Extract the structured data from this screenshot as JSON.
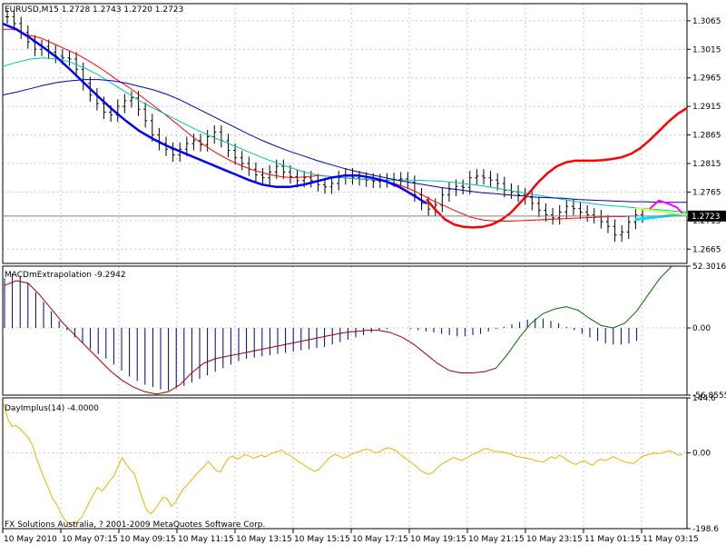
{
  "chart_data": [
    {
      "type": "candlestick",
      "title": "EURUSD,M15  1.2728 1.2743 1.2720 1.2723",
      "ylim": [
        1.264,
        1.3095
      ],
      "yticks": [
        "1.3065",
        "1.3015",
        "1.2965",
        "1.2915",
        "1.2865",
        "1.2815",
        "1.2765",
        "1.2715",
        "1.2665"
      ],
      "current_price": "1.2723",
      "bars": [
        1.3072,
        1.306,
        1.3045,
        1.3028,
        1.3015,
        1.302,
        1.301,
        1.3003,
        1.3,
        1.2998,
        1.298,
        1.2955,
        1.2935,
        1.292,
        1.2905,
        1.29,
        1.2915,
        1.2925,
        1.293,
        1.291,
        1.289,
        1.2865,
        1.285,
        1.284,
        1.283,
        1.284,
        1.285,
        1.2855,
        1.2848,
        1.2862,
        1.287,
        1.2855,
        1.2838,
        1.2825,
        1.2815,
        1.2805,
        1.2795,
        1.279,
        1.28,
        1.281,
        1.28,
        1.2792,
        1.2785,
        1.279,
        1.2785,
        1.2778,
        1.2774,
        1.278,
        1.279,
        1.2795,
        1.279,
        1.2788,
        1.2786,
        1.2784,
        1.2785,
        1.2786,
        1.2787,
        1.2788,
        1.2782,
        1.276,
        1.2745,
        1.2735,
        1.2742,
        1.276,
        1.277,
        1.2775,
        1.2773,
        1.279,
        1.2793,
        1.279,
        1.2786,
        1.278,
        1.2768,
        1.2765,
        1.276,
        1.2755,
        1.2745,
        1.2733,
        1.2725,
        1.272,
        1.273,
        1.274,
        1.2736,
        1.273,
        1.2725,
        1.2722,
        1.2713,
        1.2705,
        1.269,
        1.2695,
        1.2712,
        1.2725,
        1.2723
      ],
      "series": [
        {
          "values": [
            1.305,
            1.305,
            1.304,
            1.3035,
            1.3025,
            1.3015,
            1.3005,
            1.2992,
            1.2978,
            1.2962,
            1.2948,
            1.2932,
            1.2915,
            1.2898,
            1.288,
            1.2862,
            1.2846,
            1.2832,
            1.282,
            1.281,
            1.2802,
            1.2796,
            1.2792,
            1.279,
            1.2792,
            1.2794,
            1.2792,
            1.279,
            1.2788,
            1.2787,
            1.2785,
            1.278,
            1.2772,
            1.2762,
            1.275,
            1.274,
            1.273,
            1.2721,
            1.2716,
            1.2714,
            1.2714,
            1.2715,
            1.2716,
            1.2717,
            1.2718,
            1.2719,
            1.272,
            1.2721,
            1.2722,
            1.2722,
            1.2723
          ],
          "color": "#ff0000"
        },
        {
          "values": [
            1.2985,
            1.2992,
            1.2998,
            1.3,
            1.2998,
            1.2992,
            1.2982,
            1.297,
            1.2955,
            1.294,
            1.2925,
            1.2912,
            1.29,
            1.2888,
            1.2876,
            1.2865,
            1.2855,
            1.2845,
            1.2835,
            1.2825,
            1.2816,
            1.2808,
            1.28,
            1.2795,
            1.2792,
            1.279,
            1.2788,
            1.2787,
            1.2786,
            1.2786,
            1.2786,
            1.2785,
            1.2784,
            1.2782,
            1.2779,
            1.2776,
            1.2772,
            1.2768,
            1.2764,
            1.276,
            1.2756,
            1.2752,
            1.2748,
            1.2745,
            1.2742,
            1.274,
            1.2738,
            1.2736,
            1.2734,
            1.2732,
            1.273
          ],
          "color": "#00c8a0"
        },
        {
          "values": [
            1.2935,
            1.294,
            1.2946,
            1.2952,
            1.2957,
            1.296,
            1.2962,
            1.2962,
            1.296,
            1.2956,
            1.295,
            1.2944,
            1.2936,
            1.2926,
            1.2914,
            1.2902,
            1.289,
            1.2878,
            1.2866,
            1.2855,
            1.2845,
            1.2836,
            1.2828,
            1.282,
            1.2813,
            1.2806,
            1.28,
            1.2795,
            1.279,
            1.2785,
            1.2781,
            1.2777,
            1.2773,
            1.277,
            1.2767,
            1.2764,
            1.2762,
            1.276,
            1.2758,
            1.2756,
            1.2755,
            1.2754,
            1.2752,
            1.2751,
            1.275,
            1.2749,
            1.2748,
            1.2748,
            1.2747,
            1.2747,
            1.2747
          ],
          "color": "#0000b4"
        },
        {
          "values": [
            1.306,
            1.305,
            1.3035,
            1.3018,
            1.3,
            1.2978,
            1.2955,
            1.2932,
            1.291,
            1.289,
            1.2872,
            1.2858,
            1.2846,
            1.2836,
            1.2826,
            1.2816,
            1.2806,
            1.2796,
            1.2786,
            1.2778,
            1.2774,
            1.2774,
            1.2778,
            1.2784,
            1.279,
            1.2794,
            1.2794,
            1.279,
            1.2784,
            1.2774,
            1.276,
            1.2745
          ],
          "color": "#0000ff"
        },
        {
          "values": [
            1.2752,
            1.2733,
            1.2717,
            1.2708,
            1.2704,
            1.2703,
            1.2704,
            1.2708,
            1.2716,
            1.2728,
            1.2745,
            1.2763,
            1.2782,
            1.2798,
            1.281,
            1.2817,
            1.282,
            1.282,
            1.282,
            1.2821,
            1.2823,
            1.2826,
            1.2832,
            1.2842,
            1.2856,
            1.2872,
            1.2888,
            1.2902,
            1.2912
          ],
          "color": "#ff0000"
        }
      ]
    },
    {
      "type": "bar",
      "title": "MACDmExtrapolation -9.2942",
      "ylim": [
        -56.8555,
        52.3016
      ],
      "yticks": [
        "52.3016",
        "0.00",
        "-56.8555"
      ],
      "values": [
        42,
        46,
        44,
        38,
        30,
        22,
        14,
        6,
        -2,
        -8,
        -13,
        -18,
        -22,
        -26,
        -31,
        -36,
        -41,
        -45,
        -48,
        -50,
        -52,
        -53,
        -51,
        -49,
        -46,
        -43,
        -40,
        -37,
        -34,
        -31,
        -28,
        -26,
        -25,
        -24,
        -23,
        -22,
        -21,
        -20,
        -19,
        -18,
        -17,
        -16,
        -14,
        -12,
        -10,
        -8,
        -6,
        -4,
        -2,
        -1,
        0,
        0,
        -1,
        -2,
        -3,
        -4,
        -5,
        -6,
        -7,
        -7,
        -6,
        -5,
        -3,
        -1,
        1,
        3,
        5,
        7,
        8,
        8,
        6,
        4,
        1,
        -2,
        -5,
        -8,
        -11,
        -13,
        -14,
        -14,
        -13,
        -11
      ],
      "series": [
        {
          "values": [
            36,
            40,
            38,
            28,
            16,
            4,
            -6,
            -16,
            -26,
            -36,
            -44,
            -50,
            -54,
            -56,
            -54,
            -48,
            -38,
            -30,
            -26,
            -24,
            -22,
            -20,
            -18,
            -16,
            -14,
            -12,
            -10,
            -8,
            -6,
            -4,
            -3,
            -2,
            -2,
            -4,
            -8,
            -14,
            -22,
            -30,
            -36,
            -38,
            -38,
            -37,
            -34,
            -22,
            -8,
            4,
            12,
            16,
            18,
            15,
            8,
            2,
            0,
            4,
            14,
            28,
            42,
            52
          ],
          "color": "#a00000",
          "split": 42,
          "color2": "#006400"
        }
      ]
    },
    {
      "type": "line",
      "title": "DayImplus(14) -4.0000",
      "ylim": [
        -198.6,
        144.6
      ],
      "yticks": [
        "144.6",
        "0.00",
        "-198.6"
      ],
      "series": [
        {
          "values": [
            128,
            90,
            70,
            72,
            64,
            52,
            40,
            22,
            -12,
            -42,
            -68,
            -94,
            -120,
            -136,
            -158,
            -176,
            -184,
            -190,
            -180,
            -170,
            -150,
            -128,
            -108,
            -90,
            -100,
            -88,
            -72,
            -60,
            -34,
            -12,
            -30,
            -44,
            -55,
            -90,
            -122,
            -150,
            -160,
            -148,
            -132,
            -116,
            -120,
            -140,
            -130,
            -110,
            -94,
            -82,
            -70,
            -58,
            -46,
            -36,
            -22,
            -34,
            -46,
            -50,
            -30,
            -14,
            -8,
            -16,
            -12,
            -4,
            -8,
            -14,
            -10,
            -6,
            -10,
            -4,
            0,
            4,
            8,
            -2,
            -6,
            -14,
            -22,
            -28,
            -36,
            -42,
            -48,
            -44,
            -32,
            -20,
            -10,
            -4,
            -8,
            -14,
            -10,
            -4,
            0,
            4,
            8,
            10,
            6,
            0,
            4,
            10,
            14,
            10,
            6,
            -4,
            -12,
            -20,
            -28,
            -36,
            -46,
            -52,
            -56,
            -50,
            -40,
            -30,
            -24,
            -18,
            -12,
            -16,
            -20,
            -14,
            -8,
            -2,
            2,
            8,
            12,
            8,
            4,
            4,
            2,
            0,
            -2,
            -8,
            -10,
            -12,
            -14,
            -16,
            -20,
            -22,
            -24,
            -16,
            -10,
            -14,
            -6,
            -12,
            -20,
            -26,
            -30,
            -24,
            -20,
            -28,
            -32,
            -22,
            -16,
            -20,
            -16,
            -10,
            -14,
            -20,
            -24,
            -26,
            -28,
            -20,
            -10,
            -6,
            -4,
            0,
            -2,
            0,
            4,
            6,
            0,
            -6,
            -4
          ],
          "color": "#e8b400"
        }
      ]
    }
  ],
  "x_labels": [
    "10 May 2010",
    "10 May 07:15",
    "10 May 09:15",
    "10 May 11:15",
    "10 May 13:15",
    "10 May 15:15",
    "10 May 17:15",
    "10 May 19:15",
    "10 May 21:15",
    "10 May 23:15",
    "11 May 01:15",
    "11 May 03:15"
  ],
  "copyright": "FX Solutions Australia, ? 2001-2009 MetaQuotes Software Corp."
}
